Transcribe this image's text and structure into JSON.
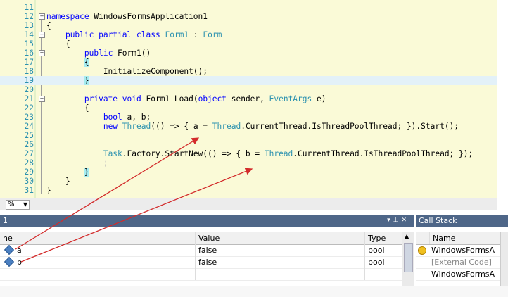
{
  "editor": {
    "lines": [
      {
        "num": "11",
        "segs": []
      },
      {
        "num": "12",
        "fold": "−",
        "segs": [
          {
            "t": "namespace",
            "c": "kw"
          },
          {
            "t": " WindowsFormsApplication1"
          }
        ]
      },
      {
        "num": "13",
        "segs": [
          {
            "t": "{"
          }
        ]
      },
      {
        "num": "14",
        "fold": "−",
        "segs": [
          {
            "t": "    "
          },
          {
            "t": "public",
            "c": "kw"
          },
          {
            "t": " "
          },
          {
            "t": "partial",
            "c": "kw"
          },
          {
            "t": " "
          },
          {
            "t": "class",
            "c": "kw"
          },
          {
            "t": " "
          },
          {
            "t": "Form1",
            "c": "ty"
          },
          {
            "t": " : "
          },
          {
            "t": "Form",
            "c": "ty"
          }
        ]
      },
      {
        "num": "15",
        "segs": [
          {
            "t": "    {"
          }
        ]
      },
      {
        "num": "16",
        "fold": "−",
        "segs": [
          {
            "t": "        "
          },
          {
            "t": "public",
            "c": "kw"
          },
          {
            "t": " Form1()"
          }
        ]
      },
      {
        "num": "17",
        "segs": [
          {
            "t": "        "
          },
          {
            "t": "{",
            "c": "br"
          }
        ]
      },
      {
        "num": "18",
        "segs": [
          {
            "t": "            InitializeComponent();"
          }
        ]
      },
      {
        "num": "19",
        "hl": true,
        "segs": [
          {
            "t": "        "
          },
          {
            "t": "}",
            "c": "br"
          }
        ]
      },
      {
        "num": "20",
        "segs": []
      },
      {
        "num": "21",
        "fold": "−",
        "segs": [
          {
            "t": "        "
          },
          {
            "t": "private",
            "c": "kw"
          },
          {
            "t": " "
          },
          {
            "t": "void",
            "c": "kw"
          },
          {
            "t": " Form1_Load("
          },
          {
            "t": "object",
            "c": "kw"
          },
          {
            "t": " sender, "
          },
          {
            "t": "EventArgs",
            "c": "ty"
          },
          {
            "t": " e)"
          }
        ]
      },
      {
        "num": "22",
        "segs": [
          {
            "t": "        {"
          }
        ]
      },
      {
        "num": "23",
        "segs": [
          {
            "t": "            "
          },
          {
            "t": "bool",
            "c": "kw"
          },
          {
            "t": " a, b;"
          }
        ]
      },
      {
        "num": "24",
        "segs": [
          {
            "t": "            "
          },
          {
            "t": "new",
            "c": "kw"
          },
          {
            "t": " "
          },
          {
            "t": "Thread",
            "c": "ty"
          },
          {
            "t": "(() => { a = "
          },
          {
            "t": "Thread",
            "c": "ty"
          },
          {
            "t": ".CurrentThread.IsThreadPoolThread; }).Start();"
          }
        ]
      },
      {
        "num": "25",
        "segs": []
      },
      {
        "num": "26",
        "segs": []
      },
      {
        "num": "27",
        "segs": [
          {
            "t": "            "
          },
          {
            "t": "Task",
            "c": "ty"
          },
          {
            "t": ".Factory.StartNew(() => { b = "
          },
          {
            "t": "Thread",
            "c": "ty"
          },
          {
            "t": ".CurrentThread.IsThreadPoolThread; });"
          }
        ]
      },
      {
        "num": "28",
        "segs": [
          {
            "t": "            "
          },
          {
            "t": ";",
            "c": "cm"
          }
        ]
      },
      {
        "num": "29",
        "segs": [
          {
            "t": "        "
          },
          {
            "t": "}",
            "c": "br"
          }
        ]
      },
      {
        "num": "30",
        "segs": [
          {
            "t": "    }"
          }
        ]
      },
      {
        "num": "31",
        "segs": [
          {
            "t": "}"
          }
        ]
      }
    ],
    "zoom_value": "%"
  },
  "locals": {
    "title": "1",
    "columns": [
      "ne",
      "Value",
      "Type"
    ],
    "rows": [
      {
        "name": "a",
        "value": "false",
        "type": "bool"
      },
      {
        "name": "b",
        "value": "false",
        "type": "bool"
      },
      {
        "name": "",
        "value": "",
        "type": ""
      }
    ]
  },
  "callstack": {
    "title": "Call Stack",
    "column": "Name",
    "rows": [
      "WindowsFormsA",
      "[External Code]",
      "WindowsFormsA"
    ]
  },
  "colors": {
    "accent": "#4e6688",
    "arrow": "#d32b2b",
    "editor_bg": "#fafad7"
  }
}
